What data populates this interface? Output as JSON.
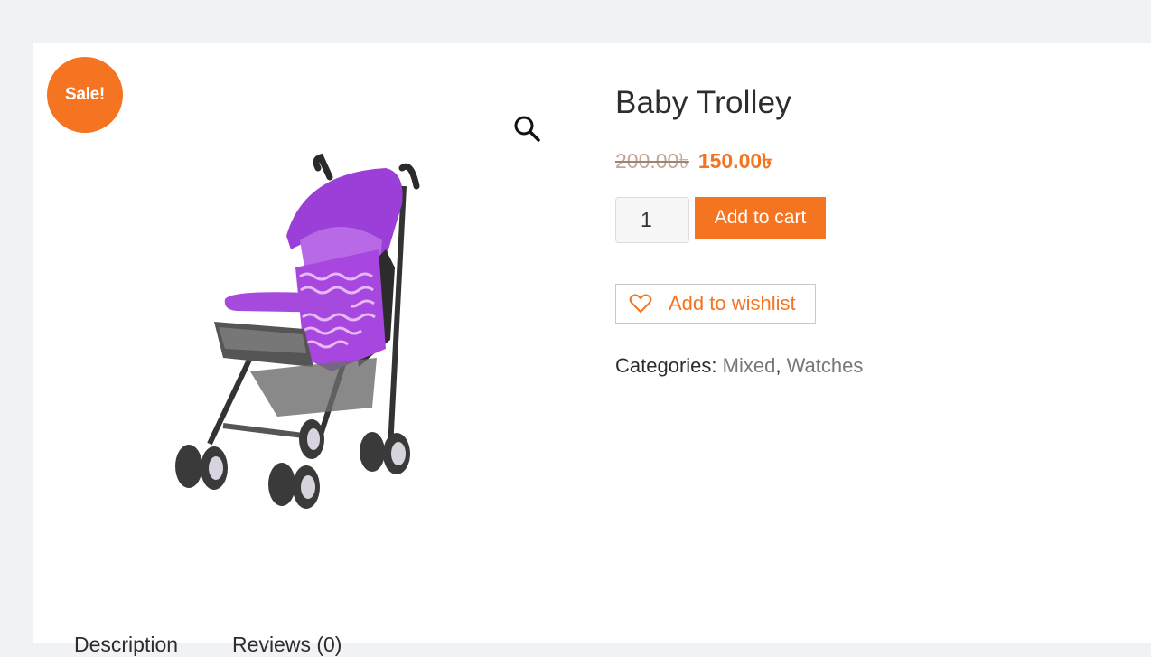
{
  "product": {
    "sale_badge": "Sale!",
    "title": "Baby Trolley",
    "old_price": "200.00৳",
    "new_price": "150.00৳",
    "quantity": "1",
    "add_to_cart": "Add to cart",
    "wishlist": "Add to wishlist",
    "categories_label": "Categories:",
    "categories": [
      "Mixed",
      "Watches"
    ],
    "category_separator": ","
  },
  "tabs": [
    "Description",
    "Reviews (0)"
  ],
  "icons": {
    "zoom": "magnifier-icon",
    "wishlist": "heart-outline-icon"
  },
  "colors": {
    "accent": "#f47421",
    "background": "#f1f2f6",
    "card": "#ffffff"
  }
}
